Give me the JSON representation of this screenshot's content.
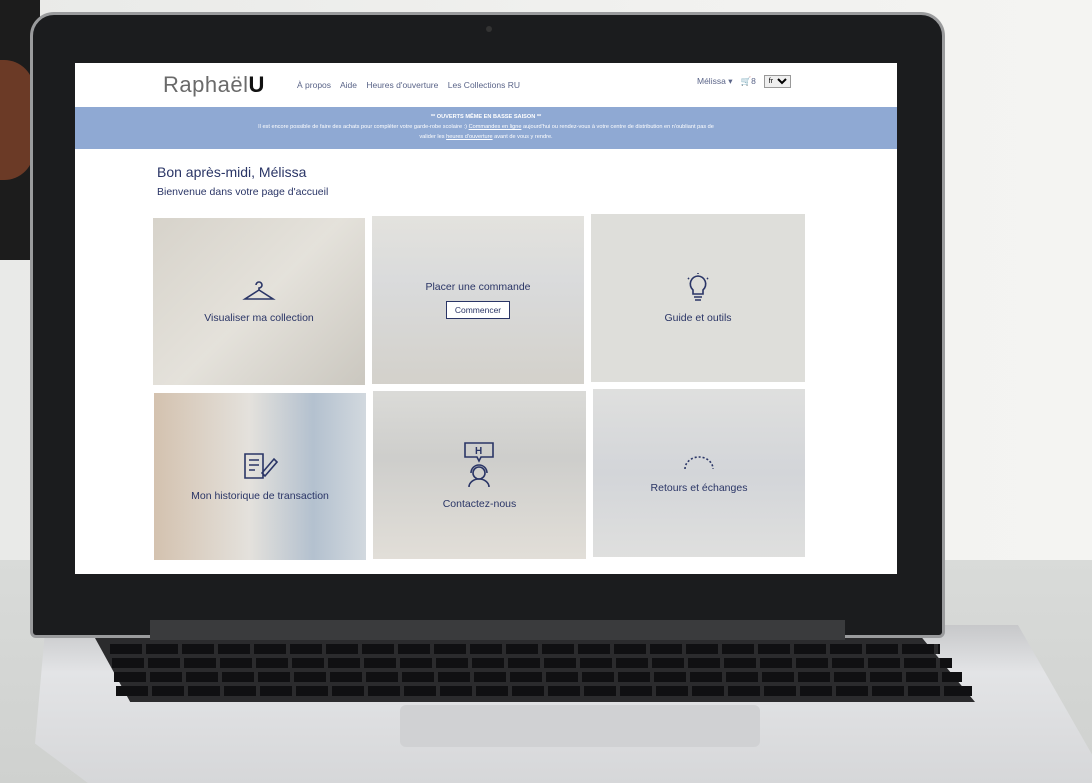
{
  "nav": {
    "logo_text": "Raphaël",
    "logo_accent": "U",
    "links": [
      "À propos",
      "Aide",
      "Heures d'ouverture",
      "Les Collections RU"
    ],
    "user": "Mélissa",
    "cart_count": "8",
    "language": "fr"
  },
  "banner": {
    "title": "** OUVERTS MÊME EN BASSE SAISON **",
    "line1_pre": "Il est encore possible de faire des achats pour compléter votre garde-robe scolaire :) ",
    "line1_link": "Commandes en ligne",
    "line1_post": " aujourd'hui ou rendez-vous à votre centre de distribution en n'oubliant pas de",
    "line2_pre": "valider les ",
    "line2_link": "heures d'ouverture",
    "line2_post": " avant de vous y rendre."
  },
  "greeting": "Bon après-midi, Mélissa",
  "subgreeting": "Bienvenue dans votre page d'accueil",
  "tiles": [
    {
      "label": "Visualiser ma collection",
      "icon": "hanger-icon"
    },
    {
      "label": "Placer une commande",
      "icon": "",
      "button": "Commencer"
    },
    {
      "label": "Guide et outils",
      "icon": "lightbulb-icon"
    },
    {
      "label": "Mon historique de transaction",
      "icon": "document-pen-icon"
    },
    {
      "label": "Contactez-nous",
      "icon": "support-agent-icon"
    },
    {
      "label": "Retours et échanges",
      "icon": "measuring-tape-icon"
    }
  ],
  "colors": {
    "accent": "#2a3566",
    "banner": "#8fa9d3"
  }
}
